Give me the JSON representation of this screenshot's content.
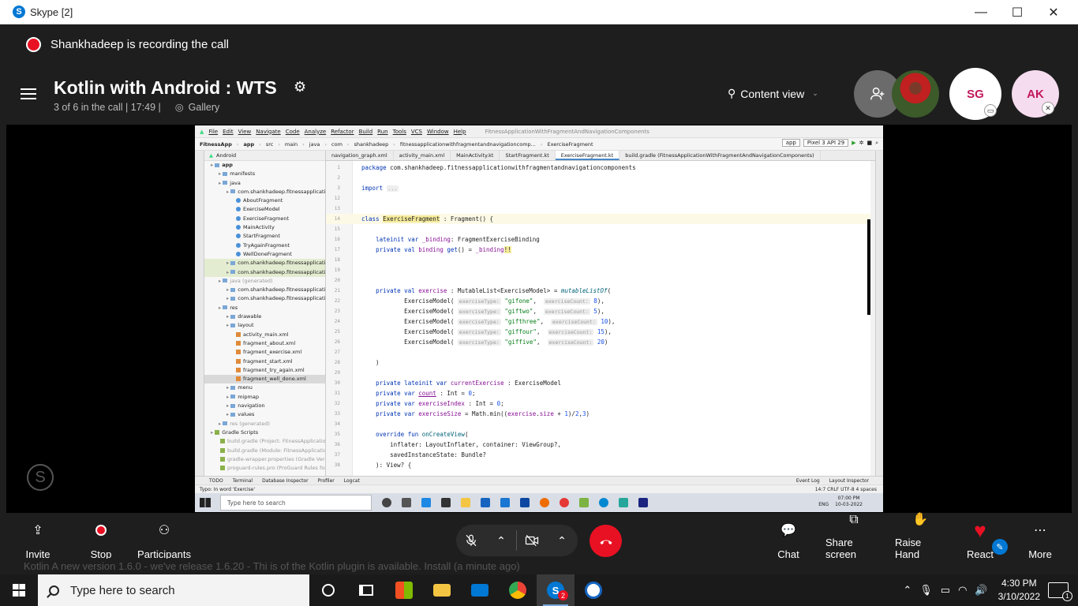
{
  "window": {
    "title": "Skype [2]",
    "logo_letter": "S",
    "minimize": "—",
    "maximize": "☐",
    "close": "✕"
  },
  "recording": {
    "text": "Shankhadeep is recording the call"
  },
  "call": {
    "title": "Kotlin with Android  : WTS",
    "subtitle": "3 of 6 in the call | 17:49 |",
    "gallery_label": "Gallery",
    "content_view_label": "Content view"
  },
  "participants_bar": {
    "avatars": [
      {
        "initials": "SG"
      },
      {
        "initials": "AK"
      }
    ]
  },
  "ide": {
    "menu": [
      "File",
      "Edit",
      "View",
      "Navigate",
      "Code",
      "Analyze",
      "Refactor",
      "Build",
      "Run",
      "Tools",
      "VCS",
      "Window",
      "Help"
    ],
    "project_title": "FitnessApplicationWithFragmentAndNavigationComponents",
    "breadcrumb": [
      "FitnessApp",
      "app",
      "src",
      "main",
      "java",
      "com",
      "shankhadeep",
      "fitnessapplicationwithfragmentandnavigationcomp...",
      "ExerciseFragment"
    ],
    "run_config": "app",
    "device": "Pixel 3 API 29",
    "panel_title": "Android",
    "tree": [
      {
        "label": "app",
        "indent": 0,
        "icon": "folder",
        "bold": true
      },
      {
        "label": "manifests",
        "indent": 1,
        "icon": "folder"
      },
      {
        "label": "java",
        "indent": 1,
        "icon": "folder"
      },
      {
        "label": "com.shankhadeep.fitnessapplication",
        "indent": 2,
        "icon": "folder"
      },
      {
        "label": "AboutFragment",
        "indent": 3,
        "icon": "kotlin"
      },
      {
        "label": "ExerciseModel",
        "indent": 3,
        "icon": "kotlin"
      },
      {
        "label": "ExerciseFragment",
        "indent": 3,
        "icon": "kotlin"
      },
      {
        "label": "MainActivity",
        "indent": 3,
        "icon": "kotlin"
      },
      {
        "label": "StartFragment",
        "indent": 3,
        "icon": "kotlin"
      },
      {
        "label": "TryAgainFragment",
        "indent": 3,
        "icon": "kotlin"
      },
      {
        "label": "WellDoneFragment",
        "indent": 3,
        "icon": "kotlin"
      },
      {
        "label": "com.shankhadeep.fitnessapplication",
        "indent": 2,
        "icon": "folder",
        "hl": true
      },
      {
        "label": "com.shankhadeep.fitnessapplication",
        "indent": 2,
        "icon": "folder",
        "hl": true
      },
      {
        "label": "java (generated)",
        "indent": 1,
        "icon": "folder"
      },
      {
        "label": "com.shankhadeep.fitnessapplication",
        "indent": 2,
        "icon": "folder"
      },
      {
        "label": "com.shankhadeep.fitnessapplication",
        "indent": 2,
        "icon": "folder"
      },
      {
        "label": "res",
        "indent": 1,
        "icon": "folder"
      },
      {
        "label": "drawable",
        "indent": 2,
        "icon": "folder"
      },
      {
        "label": "layout",
        "indent": 2,
        "icon": "folder"
      },
      {
        "label": "activity_main.xml",
        "indent": 3,
        "icon": "xml"
      },
      {
        "label": "fragment_about.xml",
        "indent": 3,
        "icon": "xml"
      },
      {
        "label": "fragment_exercise.xml",
        "indent": 3,
        "icon": "xml"
      },
      {
        "label": "fragment_start.xml",
        "indent": 3,
        "icon": "xml"
      },
      {
        "label": "fragment_try_again.xml",
        "indent": 3,
        "icon": "xml"
      },
      {
        "label": "fragment_well_done.xml",
        "indent": 3,
        "icon": "xml",
        "sel": true
      },
      {
        "label": "menu",
        "indent": 2,
        "icon": "folder"
      },
      {
        "label": "mipmap",
        "indent": 2,
        "icon": "folder"
      },
      {
        "label": "navigation",
        "indent": 2,
        "icon": "folder"
      },
      {
        "label": "values",
        "indent": 2,
        "icon": "folder"
      },
      {
        "label": "res (generated)",
        "indent": 1,
        "icon": "folder"
      },
      {
        "label": "Gradle Scripts",
        "indent": 0,
        "icon": "gradle"
      },
      {
        "label": "build.gradle (Project: FitnessApplication",
        "indent": 1,
        "icon": "gradle"
      },
      {
        "label": "build.gradle (Module: FitnessApplication",
        "indent": 1,
        "icon": "gradle"
      },
      {
        "label": "gradle-wrapper.properties (Gradle Versi",
        "indent": 1,
        "icon": "gradle"
      },
      {
        "label": "proguard-rules.pro (ProGuard Rules for",
        "indent": 1,
        "icon": "gradle"
      }
    ],
    "tabs": [
      {
        "label": "navigation_graph.xml"
      },
      {
        "label": "activity_main.xml"
      },
      {
        "label": "MainActivity.kt"
      },
      {
        "label": "StartFragment.kt"
      },
      {
        "label": "ExerciseFragment.kt",
        "active": true
      },
      {
        "label": "build.gradle (FitnessApplicationWithFragmentAndNavigationComponents)"
      }
    ],
    "code": [
      {
        "n": "1",
        "html": "<span class='kw'>package</span> com.shankhadeep.fitnessapplicationwithfragmentandnavigationcomponents"
      },
      {
        "n": "2",
        "html": ""
      },
      {
        "n": "3",
        "html": "<span class='kw'>import</span> <span class='hn'>...</span>"
      },
      {
        "n": "12",
        "html": ""
      },
      {
        "n": "13",
        "html": ""
      },
      {
        "n": "14",
        "html": "<span class='kw'>class</span> <span class='warn'>ExerciseFragment</span> : Fragment() {",
        "cur": true
      },
      {
        "n": "15",
        "html": ""
      },
      {
        "n": "16",
        "html": "    <span class='kw'>lateinit var</span> <span class='pv'>_binding</span>: FragmentExerciseBinding"
      },
      {
        "n": "17",
        "html": "    <span class='kw'>private val</span> <span class='pv'>binding</span> <span class='kw'>get</span>() = <span class='pv'>_binding</span><span class='warn'>!!</span>"
      },
      {
        "n": "18",
        "html": ""
      },
      {
        "n": "19",
        "html": ""
      },
      {
        "n": "20",
        "html": ""
      },
      {
        "n": "21",
        "html": "    <span class='kw'>private val</span> <span class='pv'>exercise</span> : MutableList&lt;ExerciseModel&gt; = <span class='fn'>mutableListOf</span>("
      },
      {
        "n": "22",
        "html": "            ExerciseModel( <span class='hn'>exerciseType:</span> <span class='st'>\"gifone\"</span>,  <span class='hn'>exerciseCount:</span> <span class='nu'>8</span>),"
      },
      {
        "n": "23",
        "html": "            ExerciseModel( <span class='hn'>exerciseType:</span> <span class='st'>\"giftwo\"</span>,  <span class='hn'>exerciseCount:</span> <span class='nu'>5</span>),"
      },
      {
        "n": "24",
        "html": "            ExerciseModel( <span class='hn'>exerciseType:</span> <span class='st'>\"gifthree\"</span>,  <span class='hn'>exerciseCount:</span> <span class='nu'>10</span>),"
      },
      {
        "n": "25",
        "html": "            ExerciseModel( <span class='hn'>exerciseType:</span> <span class='st'>\"giffour\"</span>,  <span class='hn'>exerciseCount:</span> <span class='nu'>15</span>),"
      },
      {
        "n": "26",
        "html": "            ExerciseModel( <span class='hn'>exerciseType:</span> <span class='st'>\"giffive\"</span>,  <span class='hn'>exerciseCount:</span> <span class='nu'>20</span>)"
      },
      {
        "n": "27",
        "html": ""
      },
      {
        "n": "28",
        "html": "    )"
      },
      {
        "n": "29",
        "html": ""
      },
      {
        "n": "30",
        "html": "    <span class='kw'>private lateinit var</span> <span class='pv'>currentExercise</span> : ExerciseModel"
      },
      {
        "n": "31",
        "html": "    <span class='kw'>private var</span> <span class='pv' style='text-decoration:underline'>count</span> : Int = <span class='nu'>0</span>;"
      },
      {
        "n": "32",
        "html": "    <span class='kw'>private var</span> <span class='pv'>exerciseIndex</span> : Int = <span class='nu'>0</span>;"
      },
      {
        "n": "33",
        "html": "    <span class='kw'>private var</span> <span class='pv'>exerciseSize</span> = Math.min((<span class='pv'>exercise</span>.<span class='pv'>size</span> + <span class='nu'>1</span>)/<span class='nu'>2</span>,<span class='nu'>3</span>)"
      },
      {
        "n": "34",
        "html": ""
      },
      {
        "n": "35",
        "html": "    <span class='kw'>override fun</span> <span class='fn' style='font-style:normal'>onCreateView</span>("
      },
      {
        "n": "36",
        "html": "        inflater: LayoutInflater, container: ViewGroup?,"
      },
      {
        "n": "37",
        "html": "        savedInstanceState: Bundle?"
      },
      {
        "n": "38",
        "html": "    ): View? {"
      }
    ],
    "bottom_tools": [
      "TODO",
      "Terminal",
      "Database Inspector",
      "Profiler",
      "Logcat",
      "Event Log",
      "Layout Inspector"
    ],
    "status_left": "Typo: In word 'Exercise'",
    "status_right": "14:7  CRLF  UTF-8  4 spaces",
    "inner_taskbar": {
      "search_placeholder": "Type here to search",
      "time": "07:00 PM",
      "date": "10-03-2022",
      "lang": "ENG"
    }
  },
  "controls": {
    "invite": "Invite",
    "stop": "Stop",
    "participants": "Participants",
    "chat": "Chat",
    "share_screen": "Share screen",
    "raise_hand": "Raise Hand",
    "react": "React",
    "more": "More"
  },
  "ghost_text": "Kotlin  A new version 1.6.0 - we've release 1.6.20 - Thi is of the Kotlin plugin is available. Install (a minute ago)",
  "taskbar": {
    "search_placeholder": "Type here to search",
    "skype_badge": "2",
    "time": "4:30 PM",
    "date": "3/10/2022",
    "notif_count": "1"
  },
  "colors": {
    "record_red": "#e81123",
    "skype_blue": "#0078d4",
    "avatar_pink": "#c2185b"
  }
}
